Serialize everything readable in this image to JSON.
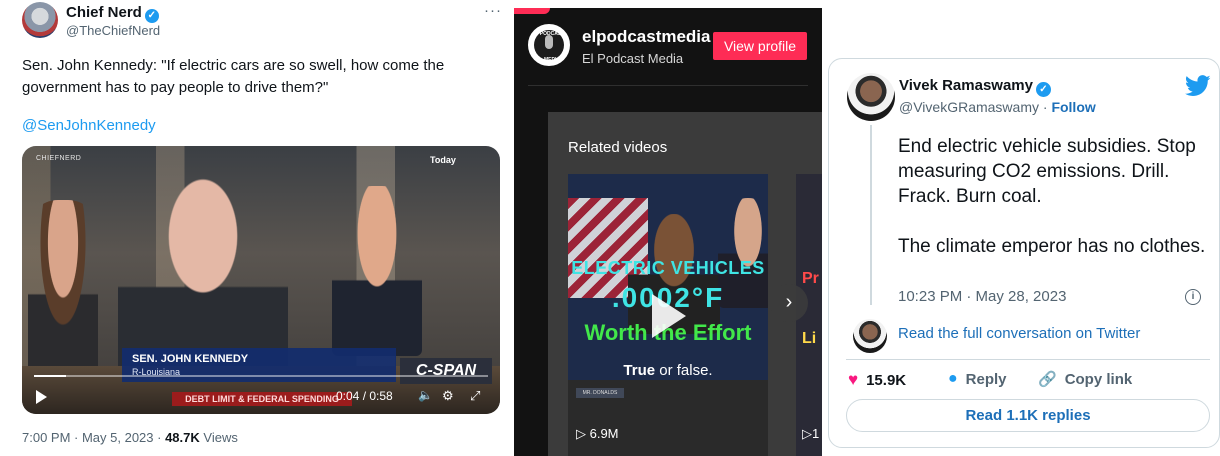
{
  "tweet1": {
    "author": "Chief Nerd",
    "handle": "@TheChiefNerd",
    "more": "···",
    "text": "Sen. John Kennedy: \"If electric cars are so swell, how come the government has to pay people to drive them?\"",
    "mention": "@SenJohnKennedy",
    "video": {
      "watermark": "CHIEFNERD",
      "badge": "Today",
      "lower_third_name": "SEN. JOHN KENNEDY",
      "lower_third_state": "R-Louisiana",
      "network": "C-SPAN",
      "ticker": "DEBT LIMIT & FEDERAL SPENDING",
      "time": "0:04 / 0:58",
      "progress": 0.07
    },
    "timestamp": "7:00 PM · May 5, 2023 · ",
    "views_count": "48.7K",
    "views_label": " Views"
  },
  "tiktok": {
    "username": "elpodcastmedia",
    "display_name": "El Podcast Media",
    "view_profile": "View profile",
    "logo_top": "EL PODCAST",
    "logo_bottom": "MEDIA",
    "related_title": "Related videos",
    "card1": {
      "line1": "ELECTRIC VEHICLES",
      "line2": ".0002°F",
      "line3": "Worth the Effort",
      "caption_true": "True",
      "caption_rest": " or false.",
      "nameplate": "MR. DONALDS",
      "views": "6.9M"
    },
    "card2": {
      "line1": "Pr",
      "line2": "Li",
      "views": "1"
    }
  },
  "tweet2": {
    "author": "Vivek Ramaswamy",
    "handle": "@VivekGRamaswamy · ",
    "follow": "Follow",
    "paragraph1": "End electric vehicle subsidies. Stop measuring CO2 emissions. Drill. Frack. Burn coal.",
    "paragraph2": "The climate emperor has no clothes.",
    "time": "10:23 PM · May 28, 2023",
    "read_full": "Read the full conversation on Twitter",
    "likes": "15.9K",
    "reply": "Reply",
    "copy_link": "Copy link",
    "read_replies": "Read 1.1K replies",
    "accent": "#1d9bf0"
  }
}
